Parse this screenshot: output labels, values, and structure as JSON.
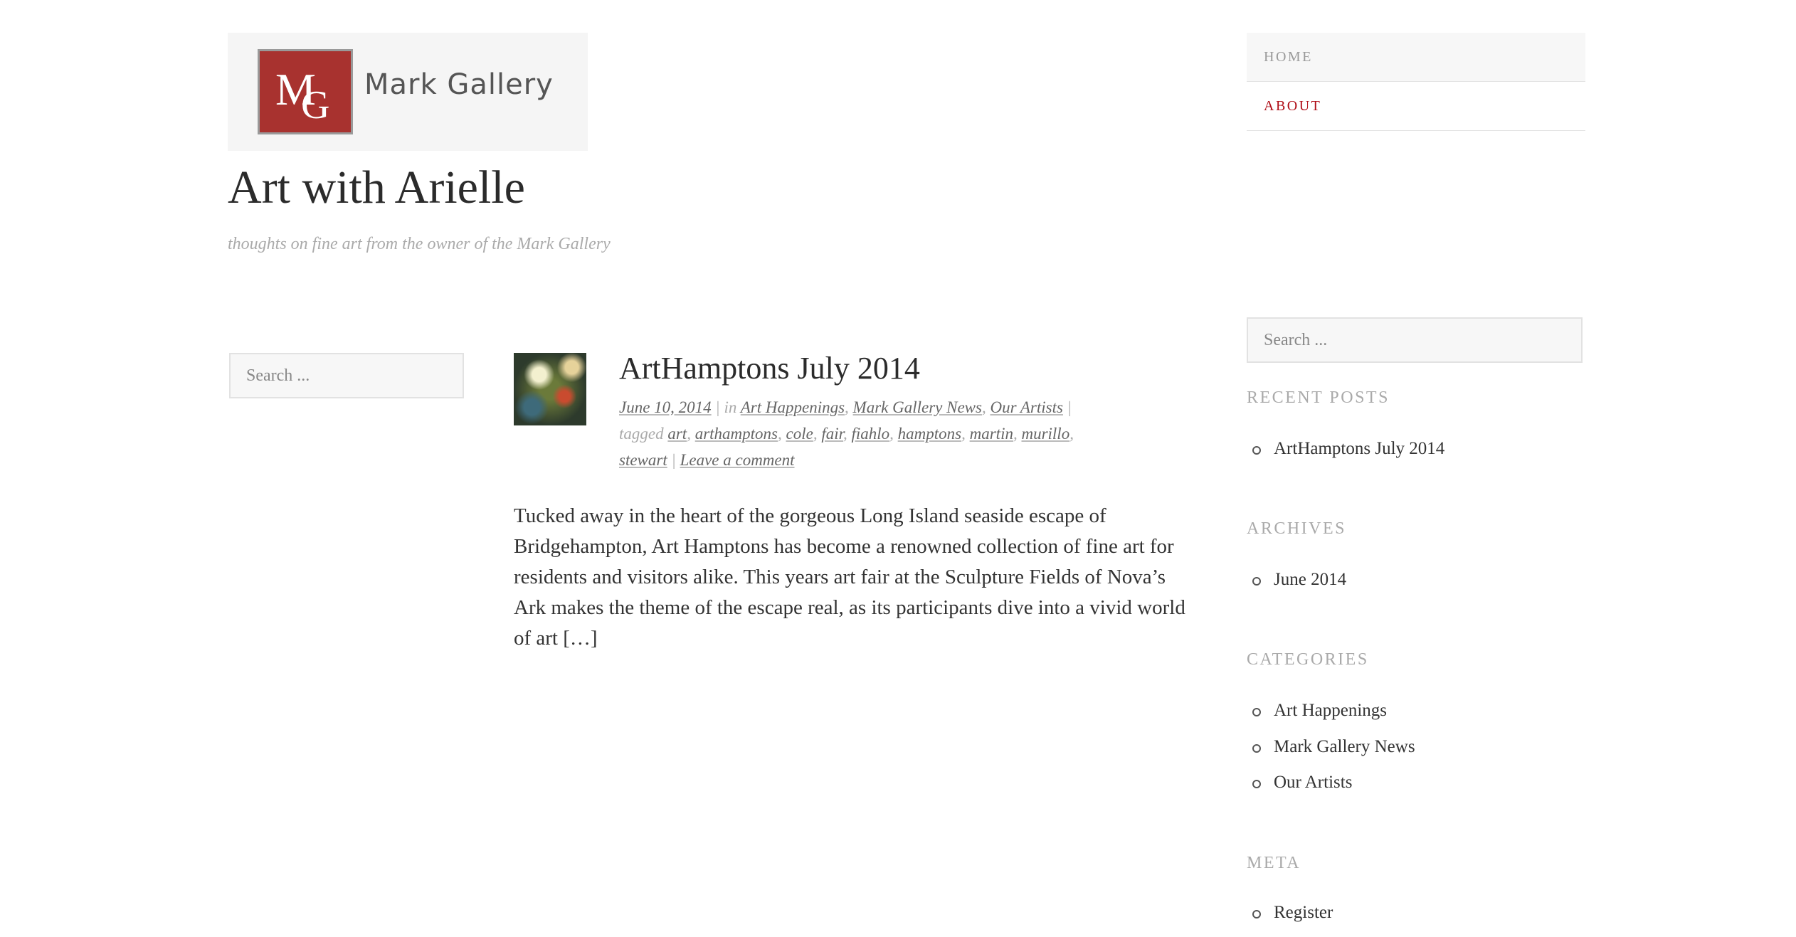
{
  "logo": {
    "monogram_top": "M",
    "monogram_bottom": "G",
    "text": "Mark Gallery"
  },
  "site": {
    "title": "Art with Arielle",
    "tagline": "thoughts on fine art from the owner of the Mark Gallery"
  },
  "nav": {
    "items": [
      {
        "label": "HOME"
      },
      {
        "label": "ABOUT"
      }
    ],
    "active_color": "#b00e17"
  },
  "left_search": {
    "placeholder": "Search ..."
  },
  "post": {
    "title": "ArtHamptons July 2014",
    "date": "June 10, 2014",
    "in_label": "in",
    "categories": [
      "Art Happenings",
      "Mark Gallery News",
      "Our Artists"
    ],
    "tagged_label": "tagged",
    "tags": [
      "art",
      "arthamptons",
      "cole",
      "fair",
      "fiahlo",
      "hamptons",
      "martin",
      "murillo",
      "stewart"
    ],
    "comment_link": "Leave a comment",
    "excerpt": "Tucked away in the heart of the gorgeous Long Island seaside escape of Bridgehampton, Art Hamptons has become a renowned collection of fine art for residents and visitors alike. This years art fair at the Sculpture Fields of Nova’s Ark makes the theme of the escape real, as its participants dive into a vivid world of art […]"
  },
  "sidebar": {
    "search": {
      "placeholder": "Search ..."
    },
    "recent_posts": {
      "title": "RECENT POSTS",
      "items": [
        "ArtHamptons July 2014"
      ]
    },
    "archives": {
      "title": "ARCHIVES",
      "items": [
        "June 2014"
      ]
    },
    "categories": {
      "title": "CATEGORIES",
      "items": [
        "Art Happenings",
        "Mark Gallery News",
        "Our Artists"
      ]
    },
    "meta": {
      "title": "META",
      "items": [
        "Register"
      ]
    }
  }
}
